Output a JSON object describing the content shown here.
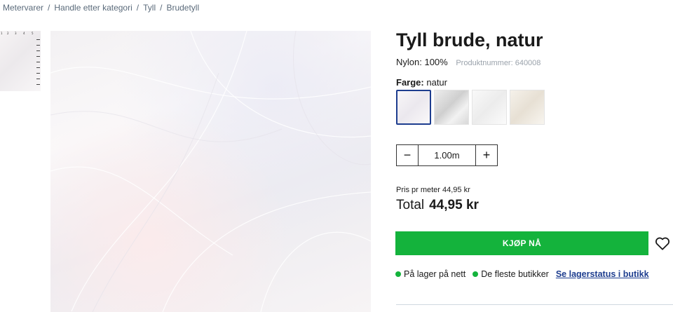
{
  "breadcrumb": [
    "Metervarer",
    "Handle etter kategori",
    "Tyll",
    "Brudetyll"
  ],
  "product": {
    "title": "Tyll brude, natur",
    "material": "Nylon: 100%",
    "product_number": "Produktnummer: 640008"
  },
  "color": {
    "label": "Farge:",
    "value": "natur"
  },
  "swatches": [
    {
      "name": "natur",
      "color": "#f4f2f4",
      "selected": true
    },
    {
      "name": "grå",
      "color": "#e2e2e2",
      "selected": false
    },
    {
      "name": "hvit",
      "color": "#f5f5f5",
      "selected": false
    },
    {
      "name": "creme",
      "color": "#f0ebe2",
      "selected": false
    }
  ],
  "quantity": {
    "minus": "−",
    "value": "1.00m",
    "plus": "+"
  },
  "price": {
    "per_meter": "Pris pr meter 44,95 kr",
    "total_label": "Total",
    "total_value": "44,95 kr"
  },
  "buy_label": "KJØP NÅ",
  "stock": {
    "online": "På lager på nett",
    "stores": "De fleste butikker",
    "link": "Se lagerstatus i butikk"
  },
  "colors": {
    "accent": "#14b33c",
    "link": "#1d3d8f"
  }
}
